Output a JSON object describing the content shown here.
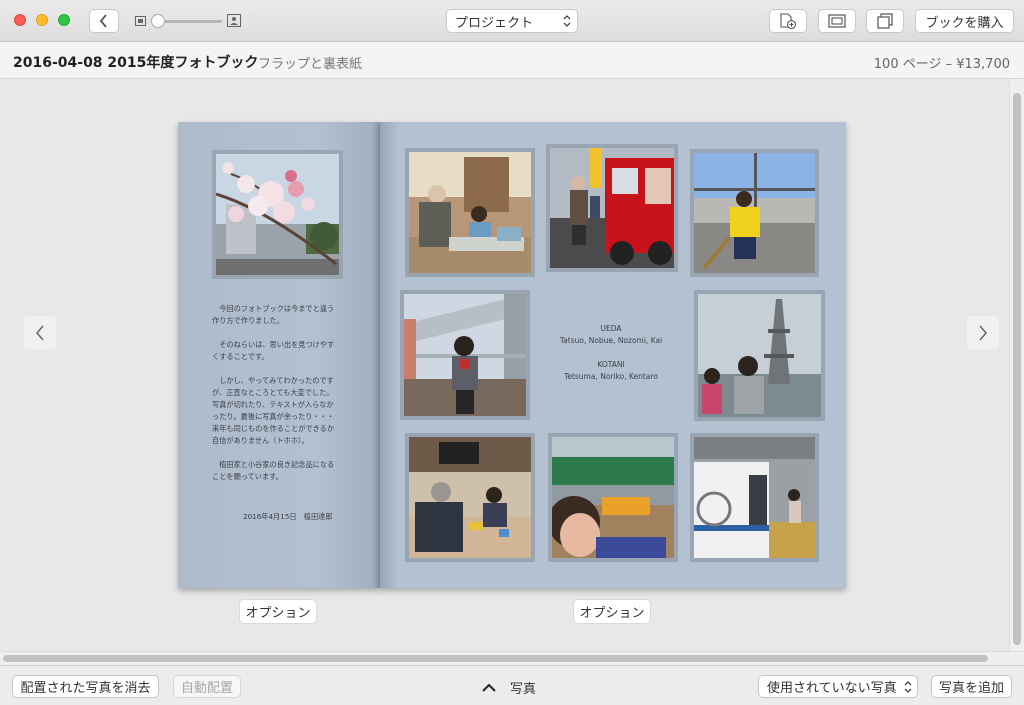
{
  "toolbar": {
    "back_icon": "chevron-left",
    "project_menu_label": "プロジェクト",
    "buy_button_label": "ブックを購入",
    "slider_value": 0.05,
    "icons": [
      "add-page-icon",
      "layout-icon",
      "page-view-icon",
      "zoom-small-icon",
      "zoom-large-icon"
    ]
  },
  "infobar": {
    "book_title": "2016-04-08 2015年度フォトブック",
    "cover_type": "フラップと裏表紙",
    "page_price": "100 ページ – ¥13,700"
  },
  "left_page": {
    "message": "　今回のフォトブックは今までと違う\n作り方で作りました。\n\n　そのねらいは、思い出を見つけやす\nくすることです。\n\n　しかし、やってみてわかったのです\nが、正直なところとても大変でした。\n写真が切れたり、テキストが入らなか\nったり。最後に写真が余ったり・・・\n来年も同じものを作ることができるか\n自信がありません（トホホ）。\n\n　植田家と小谷家の良き記念品になる\nことを願っています。",
    "signature": "2016年4月15日　植田達郎",
    "option_label": "オプション"
  },
  "right_page": {
    "family1_name": "UEDA",
    "family1_members": "Tatsuo, Nobue, Nozomi, Kai",
    "family2_name": "KOTANI",
    "family2_members": "Tetsuma, Noriko, Kentaro",
    "option_label": "オプション"
  },
  "bottombar": {
    "clear_button_label": "配置された写真を消去",
    "autofill_button_label": "自動配置",
    "photos_toggle_label": "写真",
    "filter_menu_label": "使用されていない写真",
    "add_photos_button_label": "写真を追加"
  },
  "colors": {
    "page_background": "#b4c1d1",
    "photo_mat": "#9aa5b3"
  }
}
